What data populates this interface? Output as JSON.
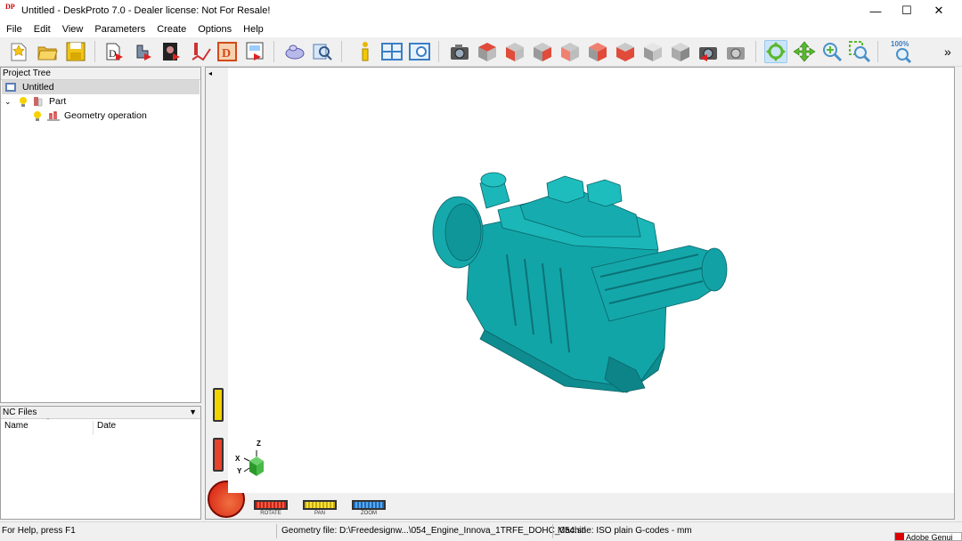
{
  "window": {
    "app_icon_text": "DP",
    "title": "Untitled - DeskProto 7.0 - Dealer license: Not For Resale!",
    "minimize": "—",
    "maximize": "☐",
    "close": "✕"
  },
  "menu": [
    "File",
    "Edit",
    "View",
    "Parameters",
    "Create",
    "Options",
    "Help"
  ],
  "toolbar": {
    "zoom_label": "100%",
    "overflow": "»",
    "icons": [
      "new-file-icon",
      "open-folder-icon",
      "save-icon",
      "geometry-wizard-icon",
      "part-wizard-icon",
      "image-wizard-icon",
      "toolpath-icon",
      "calculate-icon",
      "export-nc-icon",
      "simulation-icon",
      "preview-icon",
      "info-icon",
      "window-layout-icon",
      "view-info-icon",
      "screenshot-icon",
      "view-top-icon",
      "view-front-icon",
      "view-right-icon",
      "view-left-icon",
      "view-back-icon",
      "view-bottom-icon",
      "view-iso-icon",
      "view-iso2-icon",
      "render-icon",
      "render-toggle-icon",
      "rotate-tool-icon",
      "pan-tool-icon",
      "zoom-in-icon",
      "zoom-window-icon",
      "zoom-fit-icon"
    ]
  },
  "project_tree": {
    "header": "Project Tree",
    "items": [
      {
        "label": "Untitled"
      },
      {
        "label": "Part"
      },
      {
        "label": "Geometry operation"
      }
    ]
  },
  "nc_files": {
    "header": "NC Files",
    "columns": [
      "Name",
      "Date"
    ]
  },
  "viewport": {
    "axis_labels": {
      "z": "Z",
      "x": "X",
      "y": "Y"
    },
    "controls": [
      {
        "label": "ROTATE"
      },
      {
        "label": "PAN"
      },
      {
        "label": "ZOOM"
      }
    ],
    "model_color": "#11a3a6"
  },
  "status": {
    "help": "For Help, press F1",
    "geometry": "Geometry file: D:\\Freedesignw...\\054_Engine_Innova_1TRFE_DOHC_054.stl",
    "machine": "Machine: ISO plain G-codes - mm",
    "taskbar_peek": "Adobe Genui"
  }
}
